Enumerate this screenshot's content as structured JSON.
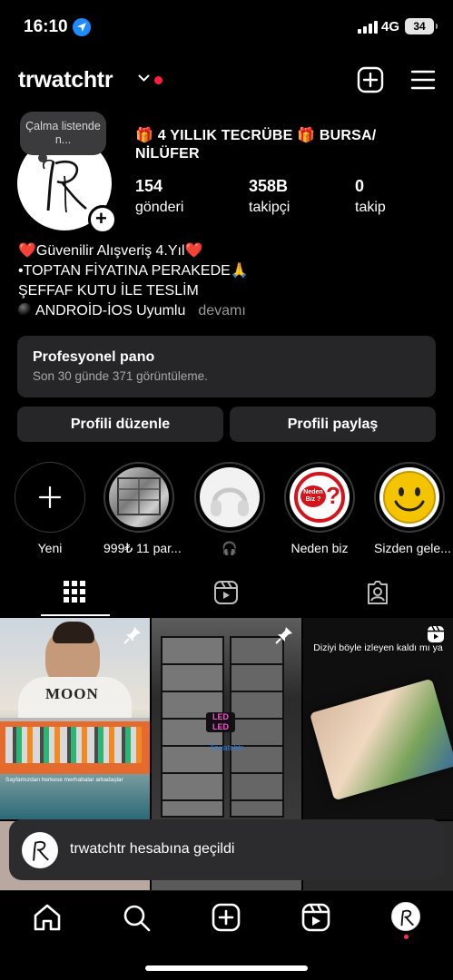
{
  "status_bar": {
    "time": "16:10",
    "network": "4G",
    "battery": "34"
  },
  "header": {
    "username": "trwatchtr"
  },
  "note": {
    "text": "Çalma listende n..."
  },
  "profile": {
    "title": "🎁 4 YILLIK TECRÜBE 🎁 BURSA/ NİLÜFER",
    "stats": [
      {
        "value": "154",
        "label": "gönderi"
      },
      {
        "value": "358B",
        "label": "takipçi"
      },
      {
        "value": "0",
        "label": "takip"
      }
    ]
  },
  "bio": {
    "line1": "❤️Güvenilir Alışveriş 4.Yıl❤️",
    "line2": "•TOPTAN FİYATINA PERAKEDE🙏",
    "line3": "ŞEFFAF KUTU İLE TESLİM",
    "line4": "ANDROİD-İOS Uyumlu",
    "more": "devamı"
  },
  "dashboard": {
    "title": "Profesyonel pano",
    "subtitle": "Son 30 günde 371 görüntüleme."
  },
  "buttons": {
    "edit": "Profili düzenle",
    "share": "Profili paylaş"
  },
  "highlights": [
    {
      "label": "Yeni"
    },
    {
      "label": "999₺ 11 par..."
    },
    {
      "label": "🎧"
    },
    {
      "label": "Neden biz"
    },
    {
      "label": "Sizden gele..."
    }
  ],
  "highlight_art": {
    "neden_text": "Neden Biz ?"
  },
  "tabs": [
    {
      "name": "grid",
      "icon": "grid-icon",
      "selected": true
    },
    {
      "name": "reels",
      "icon": "reels-icon"
    },
    {
      "name": "tagged",
      "icon": "tagged-icon"
    }
  ],
  "grid": {
    "cell1_brand": "MOON",
    "cell1_caption": "Sayfamızdan herkese merhabalar arkadaşlar",
    "cell2_led": "LED",
    "cell2_watermark": "Trwatchtr",
    "cell3_caption": "Diziyi böyle izleyen kaldı mı ya"
  },
  "toast": {
    "text": "trwatchtr hesabına geçildi"
  },
  "nav": [
    "home-icon",
    "search-icon",
    "create-icon",
    "reels-icon",
    "profile-avatar"
  ],
  "colors": {
    "accent": "#1e8bff",
    "notify_red": "#ff1f3d",
    "surface": "#262628"
  }
}
